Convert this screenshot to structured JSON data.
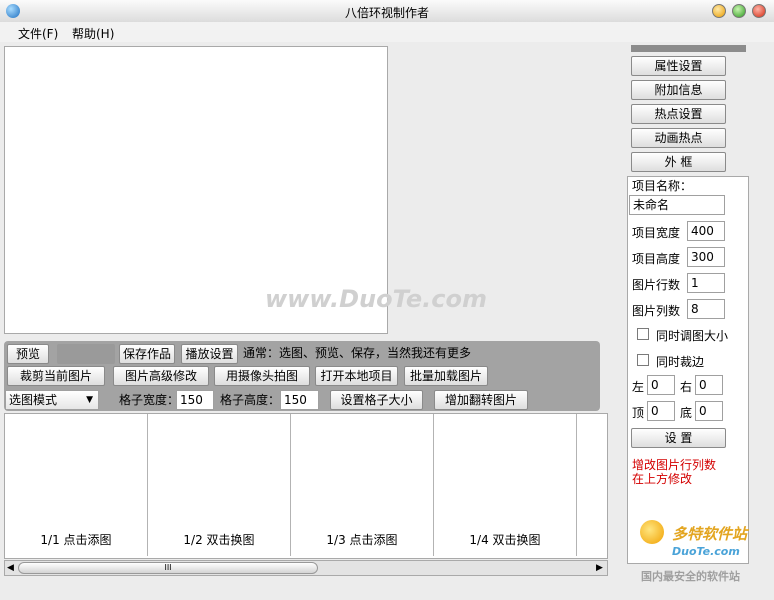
{
  "window": {
    "title": "八倍环视制作者"
  },
  "menu": {
    "file": "文件(F)",
    "help": "帮助(H)"
  },
  "toolbar": {
    "preview": "预览",
    "save_work": "保存作品",
    "play_settings": "播放设置",
    "hint": "通常：选图、预览、保存，当然我还有更多",
    "crop_current": "裁剪当前图片",
    "advanced_edit": "图片高级修改",
    "camera_shot": "用摄像头拍图",
    "open_local": "打开本地项目",
    "batch_load": "批量加载图片",
    "mode_select": "选图模式",
    "grid_width_label": "格子宽度：",
    "grid_width": "150",
    "grid_height_label": "格子高度：",
    "grid_height": "150",
    "set_grid_size": "设置格子大小",
    "add_flip": "增加翻转图片"
  },
  "cells": [
    {
      "label": "1/1 点击添图"
    },
    {
      "label": "1/2 双击换图"
    },
    {
      "label": "1/3 点击添图"
    },
    {
      "label": "1/4 双击换图"
    }
  ],
  "scrollbar": {
    "grip": "III"
  },
  "right_panel": {
    "buttons": [
      "属性设置",
      "附加信息",
      "热点设置",
      "动画热点",
      "外 框"
    ],
    "project_name_label": "项目名称：",
    "project_name": "未命名",
    "project_width_label": "项目宽度",
    "project_width": "400",
    "project_height_label": "项目高度",
    "project_height": "300",
    "rows_label": "图片行数",
    "rows": "1",
    "cols_label": "图片列数",
    "cols": "8",
    "sync_resize": "同时调图大小",
    "sync_crop": "同时裁边",
    "left_label": "左",
    "left": "0",
    "right_label": "右",
    "right": "0",
    "top_label": "顶",
    "top": "0",
    "bottom_label": "底",
    "bottom": "0",
    "apply": "设 置",
    "note_line1": "增改图片行列数",
    "note_line2": "在上方修改"
  },
  "watermarks": {
    "center": "www.DuoTe.com",
    "logo": "多特软件站",
    "logo_url": "DuoTe.com",
    "slogan": "国内最安全的软件站"
  },
  "colors": {
    "accent_red": "#d40000",
    "toolbar_gray": "#a3a3a3"
  }
}
